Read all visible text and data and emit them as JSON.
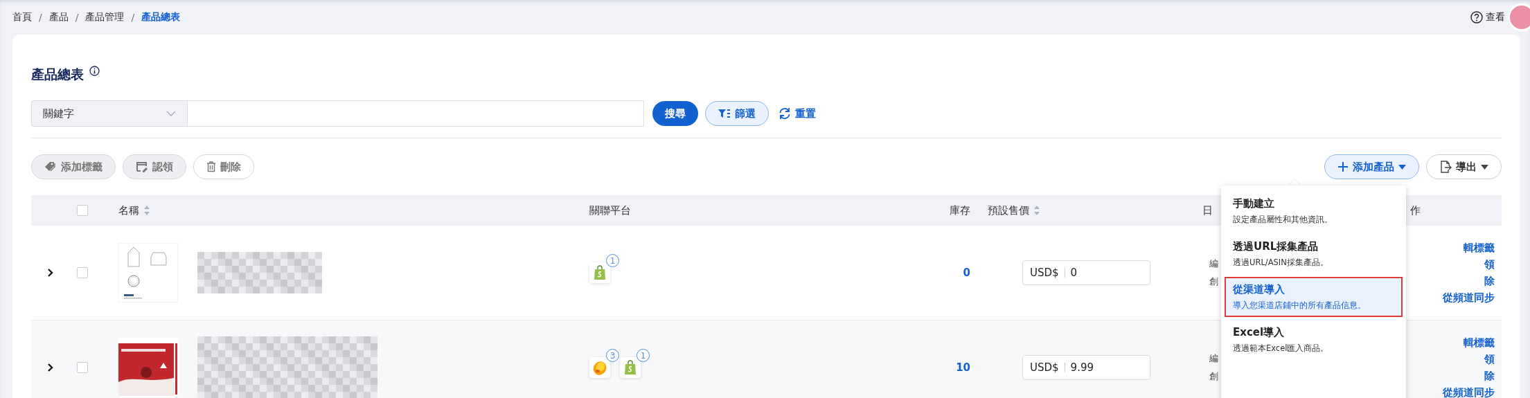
{
  "breadcrumb": [
    {
      "label": "首頁",
      "selected": false
    },
    {
      "separator": "/",
      "label": "產品",
      "selected": false
    },
    {
      "separator": "/",
      "label": "產品管理",
      "selected": false
    },
    {
      "separator": "/",
      "label": "產品總表",
      "selected": true
    }
  ],
  "help": {
    "label": "查看"
  },
  "title": "產品總表",
  "search": {
    "field_select": "關鍵字",
    "search_button": "搜尋",
    "filter_button": "篩選",
    "reset_link": "重置"
  },
  "bulk_actions": [
    {
      "label": "添加標籤",
      "kind": "tag",
      "disabled": true
    },
    {
      "label": "認領",
      "kind": "claim",
      "disabled": true
    },
    {
      "label": "刪除",
      "kind": "trash",
      "disabled": false
    }
  ],
  "toolbar": {
    "add_button": "添加產品",
    "export_button": "導出"
  },
  "table": {
    "columns": [
      {
        "label": "名稱",
        "sortable": true
      },
      {
        "label": "關聯平台",
        "sortable": false
      },
      {
        "label": "庫存",
        "sortable": false
      },
      {
        "label": "預設售價",
        "sortable": true
      },
      {
        "label": "日",
        "sortable": false
      },
      {
        "label": "作",
        "sortable": false
      }
    ],
    "header_checked": false,
    "rows": [
      {
        "checked": false,
        "platforms": [
          {
            "kind": "bag",
            "count": "1"
          }
        ],
        "stock": "0",
        "currency": "USD$",
        "price": "0",
        "date_lines": [
          "編",
          "創"
        ],
        "actions": [
          "輯標籤",
          "領",
          "除",
          "從頻道同步"
        ]
      },
      {
        "checked": false,
        "platforms": [
          {
            "kind": "egg",
            "count": "3"
          },
          {
            "kind": "bag",
            "count": "1"
          }
        ],
        "stock": "10",
        "currency": "USD$",
        "price": "9.99",
        "date_lines": [
          "編",
          "創"
        ],
        "actions": [
          "輯標籤",
          "領",
          "除",
          "從頻道同步"
        ]
      }
    ]
  },
  "add_menu": [
    {
      "title": "手動建立",
      "description": "設定產品屬性和其他資訊。",
      "selected": false
    },
    {
      "title": "透過URL採集產品",
      "description": "透過URL/ASIN採集產品。",
      "selected": false
    },
    {
      "title": "從渠道導入",
      "description": "導入您渠道店鋪中的所有產品信息。",
      "selected": true
    },
    {
      "title": "Excel導入",
      "description": "透過範本Excel匯入商品。",
      "selected": false
    }
  ]
}
